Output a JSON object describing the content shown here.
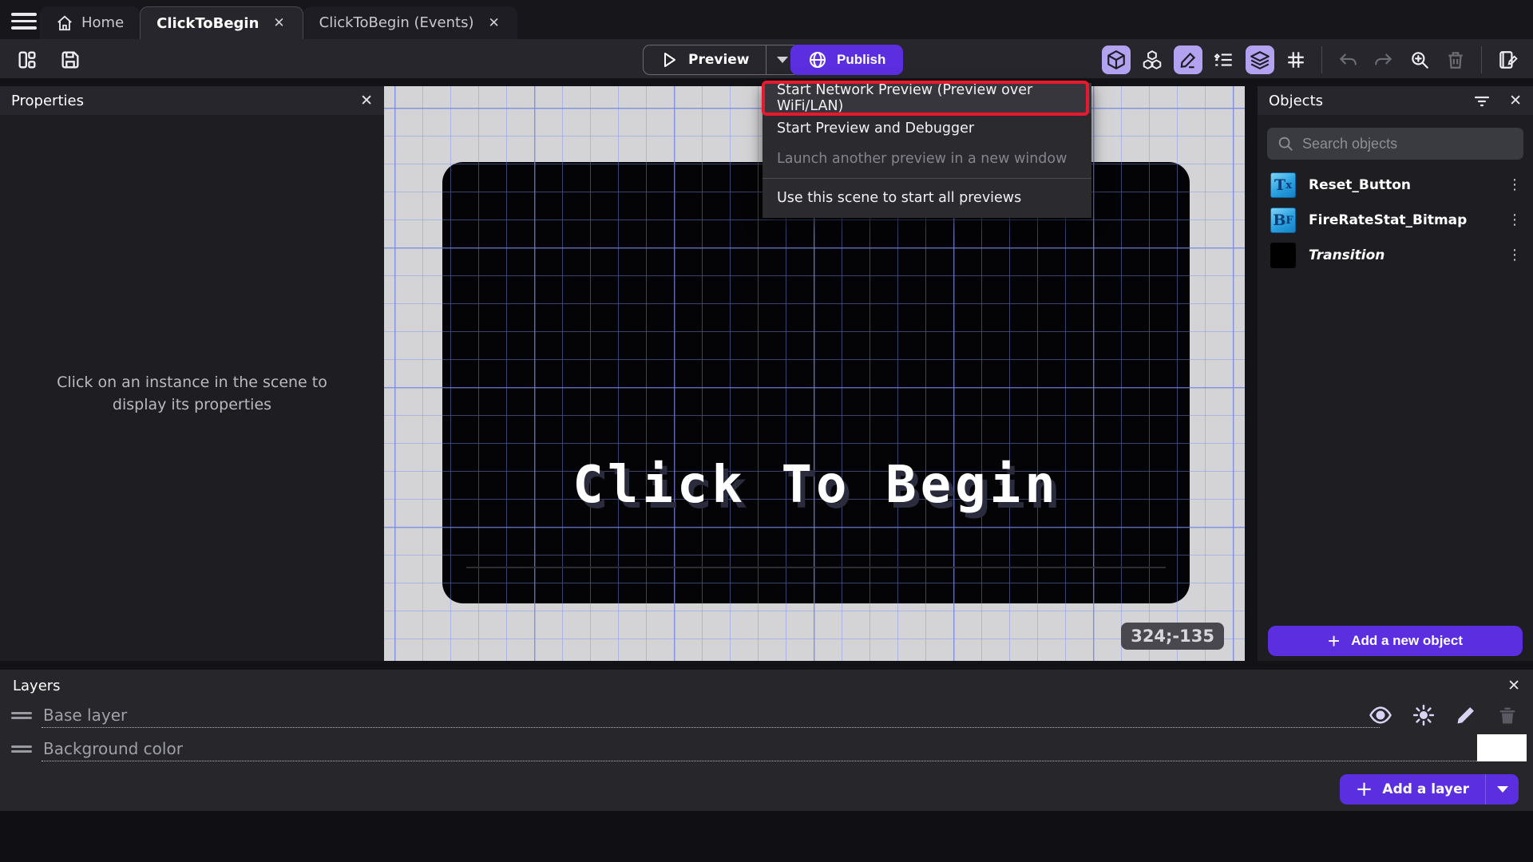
{
  "tabs": [
    {
      "label": "Home",
      "active": false,
      "closable": false
    },
    {
      "label": "ClickToBegin",
      "active": true,
      "closable": true,
      "close_glyph": "✕"
    },
    {
      "label": "ClickToBegin (Events)",
      "active": false,
      "closable": true,
      "close_glyph": "✕"
    }
  ],
  "toolbar": {
    "preview_label": "Preview",
    "publish_label": "Publish"
  },
  "preview_menu": {
    "items": [
      {
        "label": "Start Network Preview (Preview over WiFi/LAN)",
        "highlighted": true
      },
      {
        "label": "Start Preview and Debugger"
      },
      {
        "label": "Launch another preview in a new window",
        "disabled": true
      },
      {
        "label": "Use this scene to start all previews"
      }
    ]
  },
  "properties_panel": {
    "title": "Properties",
    "empty_message": "Click on an instance in the scene to display its properties",
    "close_glyph": "✕"
  },
  "scene": {
    "title_text": "Click To Begin",
    "cursor_coordinates": "324;-135"
  },
  "objects_panel": {
    "title": "Objects",
    "search_placeholder": "Search objects",
    "close_glyph": "✕",
    "kebab_glyph": "⋮",
    "items": [
      {
        "name": "Reset_Button",
        "icon_main": "T",
        "icon_sub": "x",
        "icon_type": "text-object"
      },
      {
        "name": "FireRateStat_Bitmap",
        "icon_main": "B",
        "icon_sub": "F",
        "icon_type": "bitmap-text-object"
      },
      {
        "name": "Transition",
        "icon_main": "",
        "icon_sub": "",
        "icon_type": "black-square"
      }
    ],
    "add_button_label": "Add a new object",
    "plus_glyph": "+"
  },
  "layers_panel": {
    "title": "Layers",
    "close_glyph": "✕",
    "layers": [
      {
        "name": "Base layer"
      },
      {
        "name": "Background color"
      }
    ],
    "add_button_label": "Add a layer",
    "plus_glyph": "+",
    "background_swatch_color": "#c9c9c9"
  },
  "colors": {
    "accent_purple": "#5b2fe0",
    "active_icon_bg": "#b3a2f0",
    "annotation_red": "#e6192e",
    "canvas_bg": "#d4d4d6",
    "scene_bg": "#040407"
  }
}
